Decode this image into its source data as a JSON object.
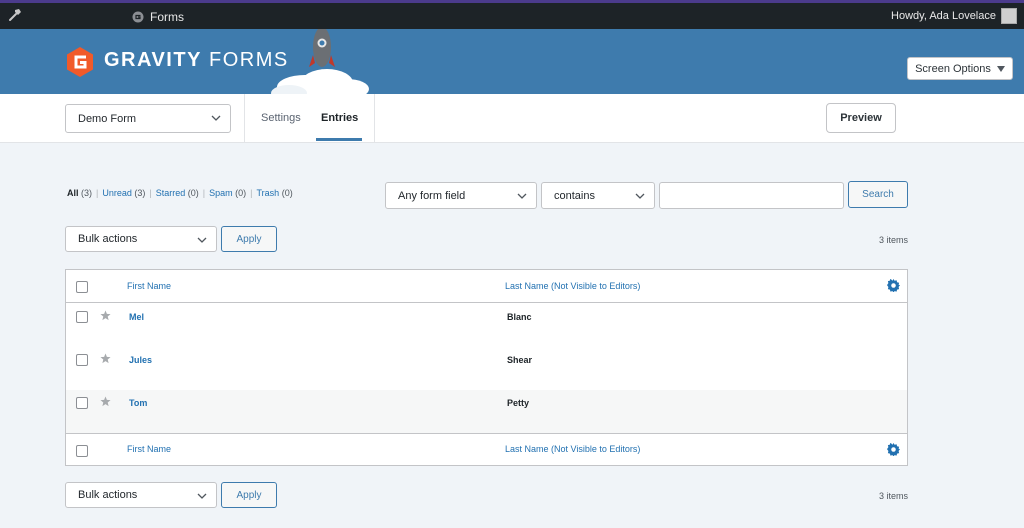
{
  "adminbar": {
    "tool_icon": "hammer-icon",
    "forms_label": "Forms",
    "forms_icon": "gravity-forms-icon",
    "howdy": "Howdy, Ada Lovelace",
    "avatar_icon": "user-avatar-icon"
  },
  "banner": {
    "brand_bold": "GRAVITY",
    "brand_rest": " FORMS",
    "logo_icon": "gravity-forms-logo",
    "rocket_icon": "rocket-icon",
    "screen_options": "Screen Options",
    "screen_options_icon": "caret-down-icon",
    "color": "#3e7bad"
  },
  "toolbar": {
    "form_name": "Demo Form",
    "tabs": [
      {
        "label": "Settings",
        "active": false
      },
      {
        "label": "Entries",
        "active": true
      }
    ],
    "preview": "Preview"
  },
  "filters": {
    "items": [
      {
        "label": "All",
        "count": "(3)",
        "current": true
      },
      {
        "label": "Unread",
        "count": "(3)",
        "current": false
      },
      {
        "label": "Starred",
        "count": "(0)",
        "current": false
      },
      {
        "label": "Spam",
        "count": "(0)",
        "current": false
      },
      {
        "label": "Trash",
        "count": "(0)",
        "current": false
      }
    ],
    "separator": "|"
  },
  "search": {
    "field_select": "Any form field",
    "operator_select": "contains",
    "value": "",
    "button": "Search"
  },
  "bulk": {
    "label": "Bulk actions",
    "apply": "Apply",
    "items_count": "3 items"
  },
  "table": {
    "columns": [
      "First Name",
      "Last Name (Not Visible to Editors)"
    ],
    "rows": [
      {
        "first": "Mel",
        "last": "Blanc",
        "starred": false
      },
      {
        "first": "Jules",
        "last": "Shear",
        "starred": false
      },
      {
        "first": "Tom",
        "last": "Petty",
        "starred": false
      }
    ],
    "gear_icon": "gear-icon",
    "star_icon": "star-icon"
  }
}
